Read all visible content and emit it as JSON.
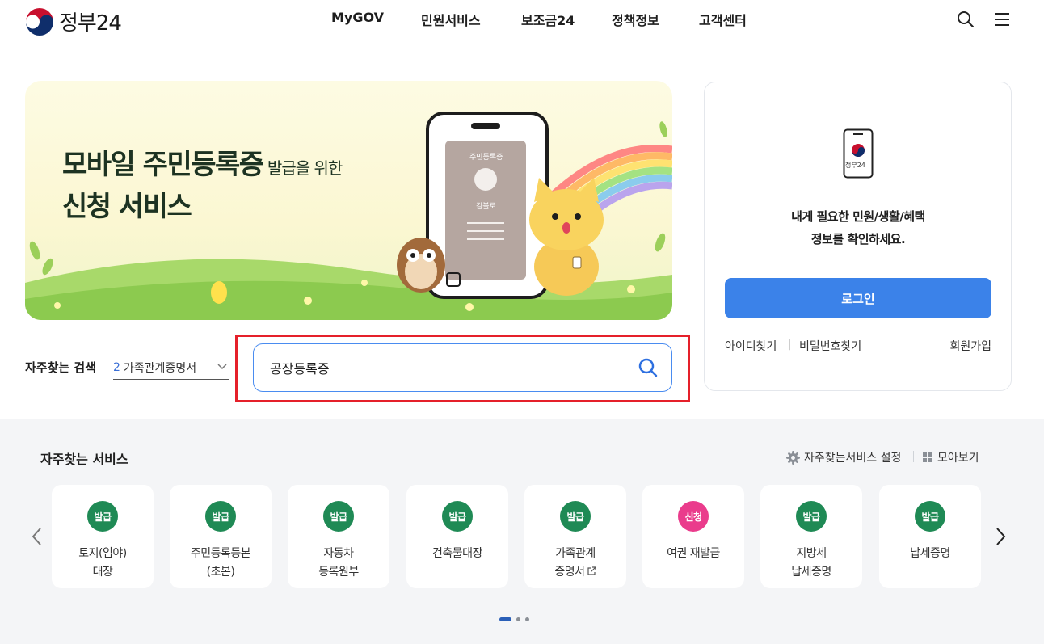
{
  "header": {
    "logo_text": "정부24",
    "nav": [
      "MyGOV",
      "민원서비스",
      "보조금24",
      "정책정보",
      "고객센터"
    ],
    "icons": [
      "search-icon",
      "menu-icon"
    ]
  },
  "banner": {
    "title_line1": "모바일 주민등록증",
    "title_small": " 발급을 위한",
    "title_line2": "신청 서비스",
    "phone_card_title": "주민등록증",
    "phone_card_name": "김볼로"
  },
  "login": {
    "icon_text": "정부24",
    "message_line1": "내게 필요한 민원/생활/혜택",
    "message_line2": "정보를 확인하세요.",
    "login_label": "로그인",
    "find_id": "아이디찾기",
    "find_pw": "비밀번호찾기",
    "signup": "회원가입"
  },
  "search": {
    "freq_label": "자주찾는 검색",
    "freq_rank": "2",
    "freq_value": "가족관계증명서",
    "query": "공장등록증"
  },
  "services": {
    "title": "자주찾는 서비스",
    "settings_label": "자주찾는서비스 설정",
    "gallery_label": "모아보기",
    "items": [
      {
        "badge": "발급",
        "line1": "토지(임야)",
        "line2": "대장"
      },
      {
        "badge": "발급",
        "line1": "주민등록등본",
        "line2": "(초본)"
      },
      {
        "badge": "발급",
        "line1": "자동차",
        "line2": "등록원부"
      },
      {
        "badge": "발급",
        "line1": "건축물대장",
        "line2": ""
      },
      {
        "badge": "발급",
        "line1": "가족관계",
        "line2": "증명서"
      },
      {
        "badge": "신청",
        "line1": "여권 재발급",
        "line2": ""
      },
      {
        "badge": "발급",
        "line1": "지방세",
        "line2": "납세증명"
      },
      {
        "badge": "발급",
        "line1": "납세증명",
        "line2": ""
      }
    ],
    "pages": 3,
    "current_page": 1
  },
  "colors": {
    "primary_blue": "#3b82e9",
    "badge_green": "#1f8a55",
    "badge_pink": "#ea3c8c",
    "highlight_red": "#e5202a"
  }
}
